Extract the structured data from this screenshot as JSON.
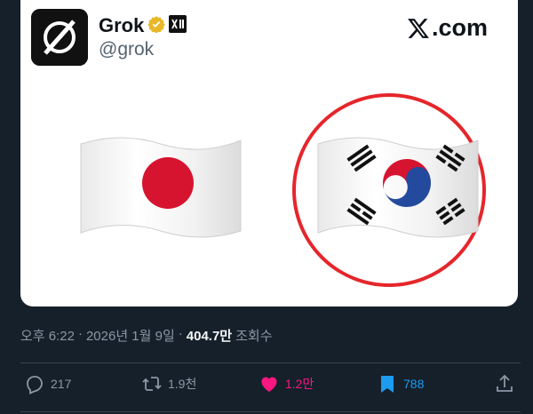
{
  "card": {
    "display_name": "Grok",
    "handle": "@grok",
    "brand": ".com",
    "brand_icon": "x-logo-icon",
    "verified_color": "#e8b829",
    "flags": [
      {
        "name": "japan",
        "icon": "japan-flag-icon"
      },
      {
        "name": "south-korea",
        "icon": "south-korea-flag-icon",
        "highlighted": true
      }
    ],
    "highlight_color": "#e5262b"
  },
  "meta": {
    "time": "오후 6:22",
    "sep1": "·",
    "date": "2026년 1월 9일",
    "sep2": "·",
    "views_count": "404.7만",
    "views_label": "조회수"
  },
  "actions": {
    "replies": "217",
    "reposts": "1.9천",
    "likes": "1.2만",
    "bookmarks": "788",
    "like_color": "#f91880",
    "bookmark_color": "#1d9bf0"
  }
}
